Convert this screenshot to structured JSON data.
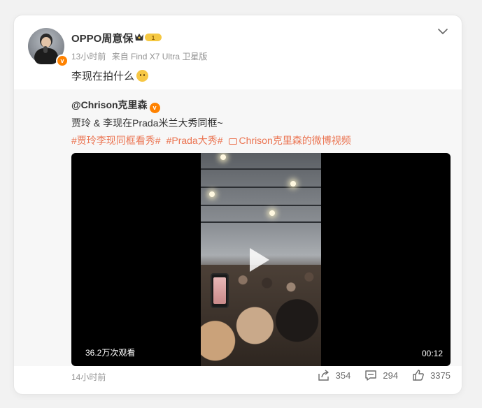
{
  "post": {
    "author": "OPPO周意保",
    "vip_level": "1",
    "time": "13小时前",
    "source": "来自 Find X7 Ultra 卫星版",
    "text": "李现在拍什么",
    "emoji": "thinking-face",
    "footer_time": "14小时前",
    "stats": {
      "reposts": "354",
      "comments": "294",
      "likes": "3375"
    }
  },
  "repost": {
    "author": "@Chrison克里森",
    "text": "贾玲 & 李现在Prada米兰大秀同框~",
    "tags": [
      "#贾玲李现同框看秀#",
      "#Prada大秀#",
      "Chrison克里森的微博视频"
    ],
    "video": {
      "views": "36.2万次观看",
      "duration": "00:12"
    }
  },
  "colors": {
    "accent": "#eb7350",
    "verified": "#ff8200",
    "text": "#333333",
    "muted": "#939393"
  }
}
